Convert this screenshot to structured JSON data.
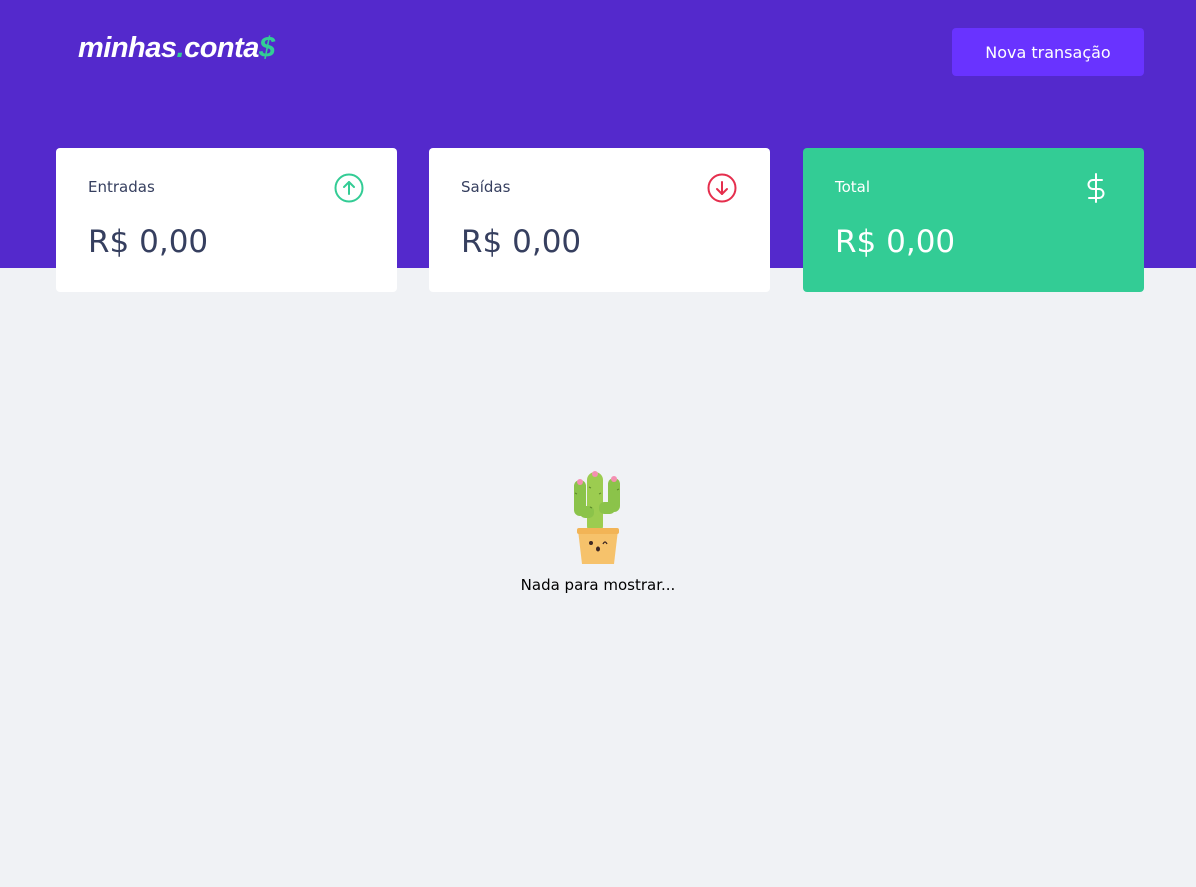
{
  "header": {
    "logo": {
      "part1": "minhas",
      "dot": ".",
      "part2": "conta",
      "dollar": "$"
    },
    "new_transaction_label": "Nova transação"
  },
  "summary": {
    "income": {
      "label": "Entradas",
      "value": "R$ 0,00",
      "icon": "arrow-up-circle-icon"
    },
    "outcome": {
      "label": "Saídas",
      "value": "R$ 0,00",
      "icon": "arrow-down-circle-icon"
    },
    "total": {
      "label": "Total",
      "value": "R$ 0,00",
      "icon": "dollar-sign-icon"
    }
  },
  "empty_state": {
    "illustration": "cactus-pot-illustration",
    "message": "Nada para mostrar..."
  },
  "colors": {
    "header_bg": "#5429cc",
    "button_bg": "#6933ff",
    "accent_green": "#33cc95",
    "accent_red": "#e52e4d",
    "page_bg": "#f0f2f5",
    "text_title": "#363f5f"
  }
}
